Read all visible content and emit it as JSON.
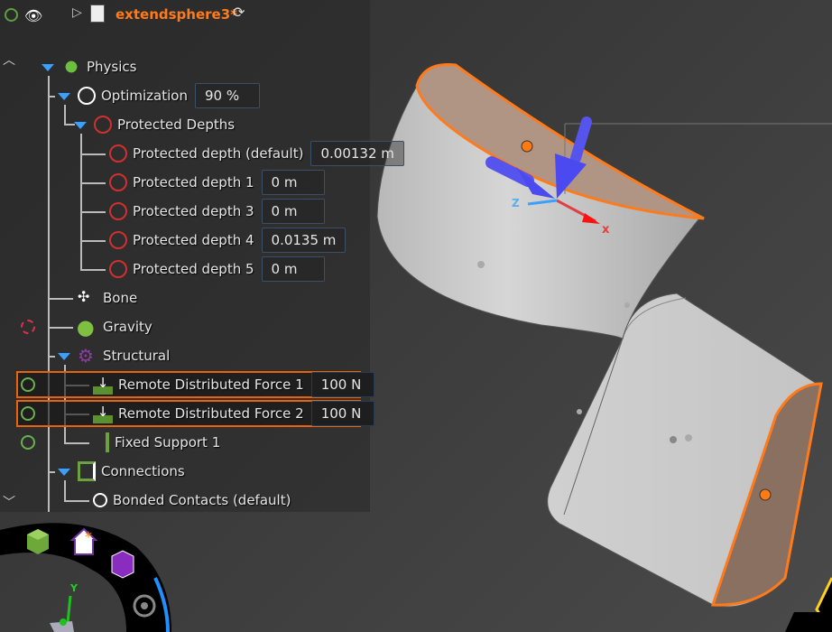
{
  "header": {
    "title": "extendsphere3*",
    "title_color": "#ff7a1a"
  },
  "tree": {
    "physics": "Physics",
    "optimization": {
      "label": "Optimization",
      "value": "90 %"
    },
    "protected_depths": "Protected Depths",
    "depths": [
      {
        "label": "Protected depth (default)",
        "value": "0.00132 m"
      },
      {
        "label": "Protected depth 1",
        "value": "0 m"
      },
      {
        "label": "Protected depth 3",
        "value": "0 m"
      },
      {
        "label": "Protected depth 4",
        "value": "0.0135 m"
      },
      {
        "label": "Protected depth 5",
        "value": "0 m"
      }
    ],
    "bone": "Bone",
    "gravity": "Gravity",
    "structural": "Structural",
    "forces": [
      {
        "label": "Remote Distributed Force 1",
        "value": "100 N"
      },
      {
        "label": "Remote Distributed Force 2",
        "value": "100 N"
      }
    ],
    "fixed_support": "Fixed Support 1",
    "connections": "Connections",
    "bonded": "Bonded Contacts (default)"
  },
  "axes": {
    "x": "x",
    "z": "z",
    "y": "Y"
  },
  "colors": {
    "accent": "#e8640a",
    "tree_arrow": "#3aa0ff"
  }
}
